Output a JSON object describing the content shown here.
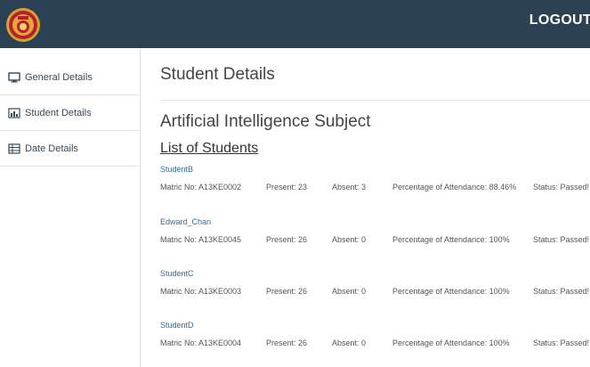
{
  "header": {
    "logout_label": "LOGOUT",
    "bar_color": "#2c4154",
    "logo_icon": "university-crest-icon"
  },
  "sidebar": {
    "items": [
      {
        "label": "General Details",
        "icon": "monitor-icon"
      },
      {
        "label": "Student Details",
        "icon": "chart-icon"
      },
      {
        "label": "Date Details",
        "icon": "table-icon"
      }
    ]
  },
  "main": {
    "page_title": "Student Details",
    "subject_title": "Artificial Intelligence Subject",
    "list_heading": "List of Students",
    "students": [
      {
        "name": "StudentB",
        "matric": "Matric No: A13KE0002",
        "present": "Present: 23",
        "absent": "Absent: 3",
        "percentage": "Percentage of Attendance: 88.46%",
        "status": "Status: Passed!"
      },
      {
        "name": "Edward_Chan",
        "matric": "Matric No: A13KE0045",
        "present": "Present: 26",
        "absent": "Absent: 0",
        "percentage": "Percentage of Attendance: 100%",
        "status": "Status: Passed!"
      },
      {
        "name": "StudentC",
        "matric": "Matric No: A13KE0003",
        "present": "Present: 26",
        "absent": "Absent: 0",
        "percentage": "Percentage of Attendance: 100%",
        "status": "Status: Passed!"
      },
      {
        "name": "StudentD",
        "matric": "Matric No: A13KE0004",
        "present": "Present: 26",
        "absent": "Absent: 0",
        "percentage": "Percentage of Attendance: 100%",
        "status": "Status: Passed!"
      }
    ]
  }
}
